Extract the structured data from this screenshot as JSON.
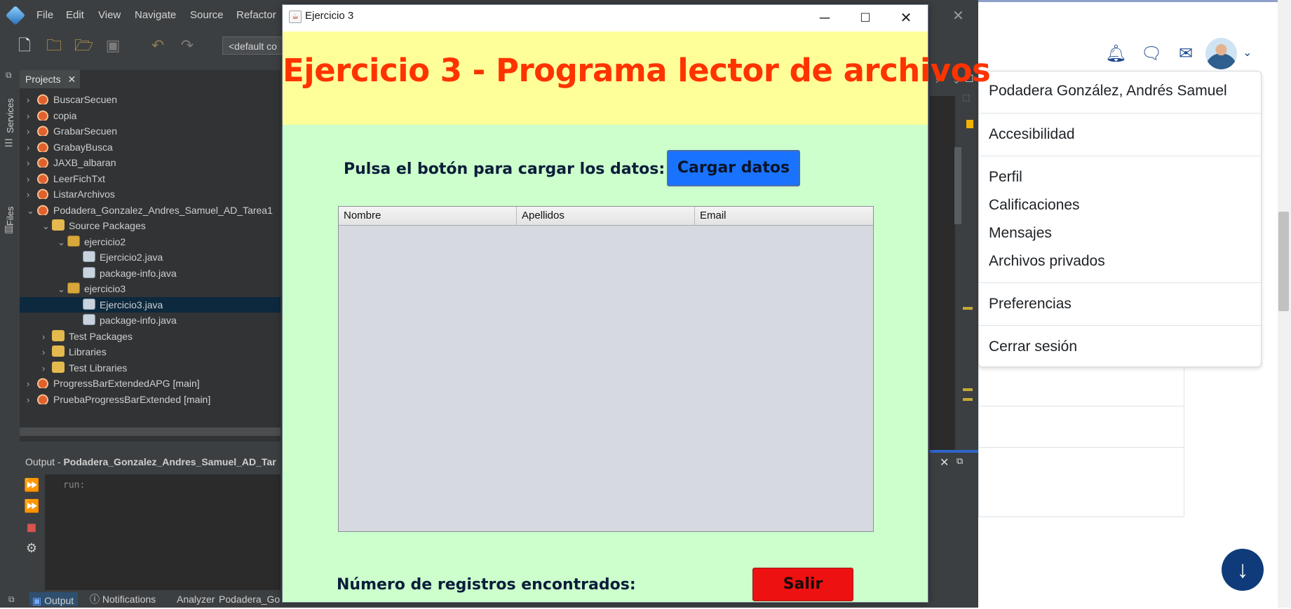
{
  "ide": {
    "menu": [
      "File",
      "Edit",
      "View",
      "Navigate",
      "Source",
      "Refactor"
    ],
    "config_combo": "<default co",
    "side_tabs": [
      "Services",
      "Files"
    ],
    "projects_tab": "Projects",
    "tree": [
      {
        "label": "BuscarSecuen",
        "icon": "project-icon",
        "level": 0,
        "chevron": "›"
      },
      {
        "label": "copia",
        "icon": "project-icon",
        "level": 0,
        "chevron": "›"
      },
      {
        "label": "GrabarSecuen",
        "icon": "project-icon",
        "level": 0,
        "chevron": "›"
      },
      {
        "label": "GrabayBusca",
        "icon": "project-icon",
        "level": 0,
        "chevron": "›"
      },
      {
        "label": "JAXB_albaran",
        "icon": "project-icon",
        "level": 0,
        "chevron": "›"
      },
      {
        "label": "LeerFichTxt",
        "icon": "project-icon",
        "level": 0,
        "chevron": "›"
      },
      {
        "label": "ListarArchivos",
        "icon": "project-icon",
        "level": 0,
        "chevron": "›"
      },
      {
        "label": "Podadera_Gonzalez_Andres_Samuel_AD_Tarea1",
        "icon": "project-icon",
        "level": 0,
        "chevron": "⌄"
      },
      {
        "label": "Source Packages",
        "icon": "folder-icon",
        "level": 1,
        "chevron": "⌄"
      },
      {
        "label": "ejercicio2",
        "icon": "package-icon",
        "level": 2,
        "chevron": "⌄"
      },
      {
        "label": "Ejercicio2.java",
        "icon": "java-file-icon",
        "level": 3,
        "chevron": ""
      },
      {
        "label": "package-info.java",
        "icon": "java-file-icon",
        "level": 3,
        "chevron": ""
      },
      {
        "label": "ejercicio3",
        "icon": "package-icon",
        "level": 2,
        "chevron": "⌄"
      },
      {
        "label": "Ejercicio3.java",
        "icon": "java-file-icon",
        "level": 3,
        "chevron": "",
        "selected": true
      },
      {
        "label": "package-info.java",
        "icon": "java-file-icon",
        "level": 3,
        "chevron": ""
      },
      {
        "label": "Test Packages",
        "icon": "folder-icon",
        "level": 1,
        "chevron": "›"
      },
      {
        "label": "Libraries",
        "icon": "folder-icon",
        "level": 1,
        "chevron": "›"
      },
      {
        "label": "Test Libraries",
        "icon": "folder-icon",
        "level": 1,
        "chevron": "›"
      },
      {
        "label": "ProgressBarExtendedAPG",
        "icon": "project-icon",
        "level": 0,
        "chevron": "›",
        "tag": "[main]"
      },
      {
        "label": "PruebaProgressBarExtended",
        "icon": "project-icon",
        "level": 0,
        "chevron": "›",
        "tag": "[main]"
      }
    ],
    "output_title_prefix": "Output - ",
    "output_title_project": "Podadera_Gonzalez_Andres_Samuel_AD_Tar",
    "output_text": "run:",
    "status_items": [
      "Output",
      "Notifications",
      "Analyzer"
    ],
    "status_project": "Podadera_Go"
  },
  "dialog": {
    "title": "Ejercicio 3",
    "heading": "Ejercicio 3 - Programa lector de archivos",
    "load_label": "Pulsa el botón para cargar los datos:",
    "load_button": "Cargar datos",
    "table_columns": [
      "Nombre",
      "Apellidos",
      "Email"
    ],
    "count_label": "Número de registros encontrados:",
    "exit_button": "Salir",
    "colors": {
      "header_bg": "#ffff99",
      "heading": "#ff3300",
      "body_bg": "#ccffcc",
      "load_button": "#1973ff",
      "exit_button": "#ee1111"
    }
  },
  "browser": {
    "user_menu": {
      "user_name": "Podadera González, Andrés Samuel",
      "items_group1": [
        "Accesibilidad"
      ],
      "items_group2": [
        "Perfil",
        "Calificaciones",
        "Mensajes",
        "Archivos privados"
      ],
      "items_group3": [
        "Preferencias"
      ],
      "logout": "Cerrar sesión"
    },
    "nav_icons": [
      "bell-icon",
      "chat-icon",
      "mail-icon"
    ],
    "accent": "#0f3b7a"
  }
}
